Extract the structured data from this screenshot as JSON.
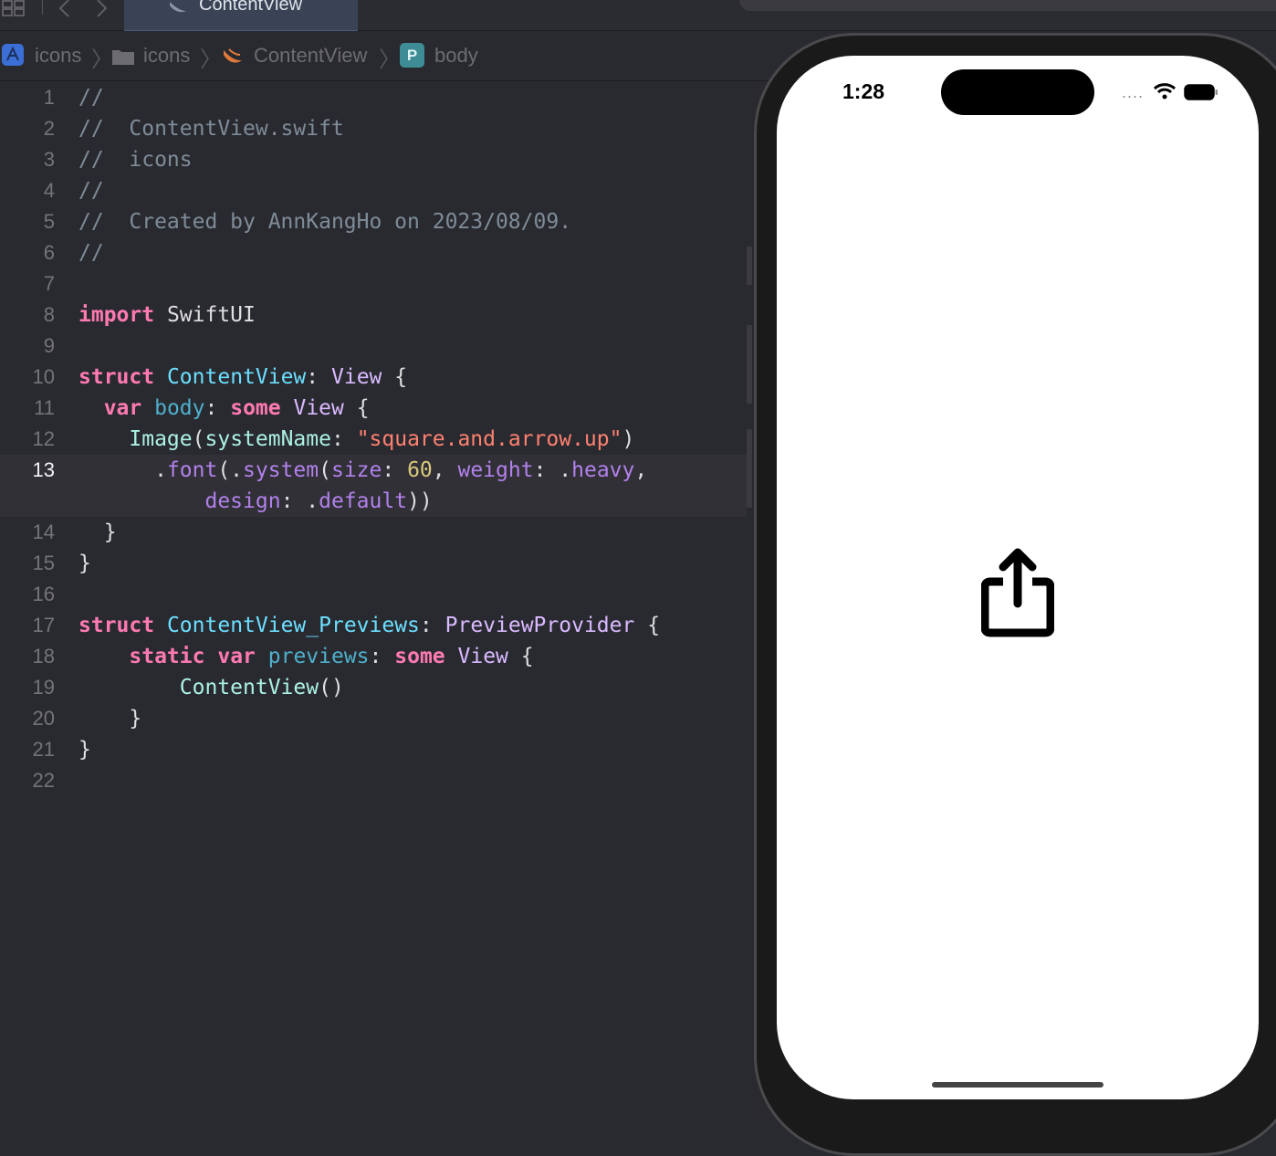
{
  "toolbar": {
    "tab_label": "ContentView"
  },
  "jumpbar": {
    "items": [
      "icons",
      "icons",
      "ContentView",
      "body"
    ],
    "body_badge": "P"
  },
  "editor": {
    "current_line": 13,
    "line_numbers": [
      "1",
      "2",
      "3",
      "4",
      "5",
      "6",
      "7",
      "8",
      "9",
      "10",
      "11",
      "12",
      "13",
      "14",
      "15",
      "16",
      "17",
      "18",
      "19",
      "20",
      "21",
      "22"
    ],
    "tokens": {
      "c1": "//",
      "c2": "//  ContentView.swift",
      "c3": "//  icons",
      "c4": "//",
      "c5": "//  Created by AnnKangHo on 2023/08/09.",
      "c6": "//",
      "import_kw": "import",
      "import_mod": " SwiftUI",
      "struct_kw": "struct",
      "cv_name": "ContentView",
      "colon": ":",
      "view": "View",
      "brace_open": " {",
      "var_kw": "var",
      "body": "body",
      "some_kw": "some",
      "image": "Image",
      "sys_name": "systemName",
      "str": "\"square.and.arrow.up\"",
      "font": "font",
      "system": "system",
      "size": "size",
      "sixty": "60",
      "weight": "weight",
      "heavy": "heavy",
      "design": "design",
      "default": "default",
      "close_brace": "}",
      "previews_name": "ContentView_Previews",
      "preview_provider": "PreviewProvider",
      "static_kw": "static",
      "previews": "previews",
      "cv_call": "ContentView",
      "parens": "()"
    }
  },
  "preview": {
    "status_time": "1:28",
    "signal_dots": "....",
    "icon": "square-and-arrow-up-icon"
  },
  "colors": {
    "keyword": "#ff7ab2",
    "type": "#dabaff",
    "declaration": "#6bdfff",
    "comment": "#7f8c98",
    "string": "#ff8170",
    "number": "#d9c97c",
    "function": "#b281eb"
  }
}
